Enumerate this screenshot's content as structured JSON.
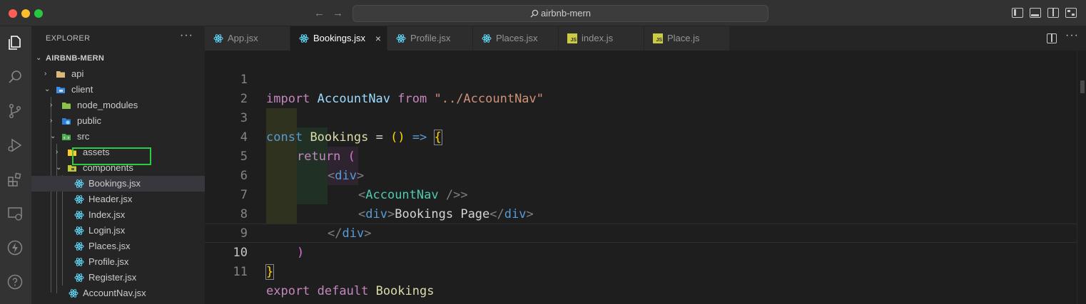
{
  "window": {
    "search_text": "airbnb-mern"
  },
  "sidebar": {
    "header": "EXPLORER",
    "more": "···",
    "project": "AIRBNB-MERN",
    "tree": [
      {
        "label": "api",
        "kind": "folder",
        "expanded": false
      },
      {
        "label": "client",
        "kind": "folder",
        "expanded": true
      },
      {
        "label": "node_modules",
        "kind": "folder",
        "expanded": false
      },
      {
        "label": "public",
        "kind": "folder",
        "expanded": false
      },
      {
        "label": "src",
        "kind": "folder",
        "expanded": true
      },
      {
        "label": "assets",
        "kind": "folder",
        "expanded": false
      },
      {
        "label": "components",
        "kind": "folder",
        "expanded": true
      },
      {
        "label": "Bookings.jsx",
        "kind": "react",
        "selected": true
      },
      {
        "label": "Header.jsx",
        "kind": "react"
      },
      {
        "label": "Index.jsx",
        "kind": "react"
      },
      {
        "label": "Login.jsx",
        "kind": "react"
      },
      {
        "label": "Places.jsx",
        "kind": "react"
      },
      {
        "label": "Profile.jsx",
        "kind": "react"
      },
      {
        "label": "Register.jsx",
        "kind": "react"
      },
      {
        "label": "AccountNav.jsx",
        "kind": "react"
      }
    ]
  },
  "tabs": [
    {
      "label": "App.jsx",
      "kind": "react",
      "active": false
    },
    {
      "label": "Bookings.jsx",
      "kind": "react",
      "active": true,
      "close": "×"
    },
    {
      "label": "Profile.jsx",
      "kind": "react",
      "active": false
    },
    {
      "label": "Places.jsx",
      "kind": "react",
      "active": false
    },
    {
      "label": "index.js",
      "kind": "js",
      "active": false
    },
    {
      "label": "Place.js",
      "kind": "js",
      "active": false
    }
  ],
  "editor": {
    "current_line": 10,
    "line_numbers": [
      "1",
      "2",
      "3",
      "4",
      "5",
      "6",
      "7",
      "8",
      "9",
      "10",
      "11"
    ],
    "tokens": {
      "l1_import": "import",
      "l1_name": "AccountNav",
      "l1_from": "from",
      "l1_path": "\"../AccountNav\"",
      "l3_const": "const",
      "l3_name": "Bookings",
      "l3_eq": "=",
      "l3_parens": "()",
      "l3_arrow": "=>",
      "l3_brace": "{",
      "l4_return": "return",
      "l4_paren": "(",
      "lt": "<",
      "gt": ">",
      "slash_lt": "</",
      "self_close": " />",
      "div": "div",
      "l6_comp": "AccountNav",
      "l7_text": "Bookings Page",
      "l9_paren": ")",
      "l10_brace": "}",
      "l11_export": "export",
      "l11_default": "default",
      "l11_name": "Bookings"
    }
  },
  "colors": {
    "selection_box": "#2ecc40",
    "react_icon": "#61dafb",
    "folder": "#dcb67a"
  }
}
